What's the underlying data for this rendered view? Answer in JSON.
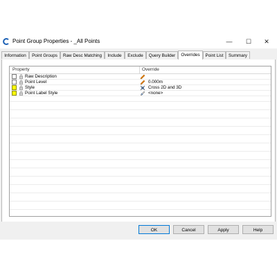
{
  "window": {
    "title": "Point Group Properties - _All Points",
    "controls": {
      "minimize": "—",
      "maximize": "☐",
      "close": "✕"
    }
  },
  "tabs": [
    {
      "label": "Information",
      "active": false
    },
    {
      "label": "Point Groups",
      "active": false
    },
    {
      "label": "Raw Desc Matching",
      "active": false
    },
    {
      "label": "Include",
      "active": false
    },
    {
      "label": "Exclude",
      "active": false
    },
    {
      "label": "Query Builder",
      "active": false
    },
    {
      "label": "Overrides",
      "active": true
    },
    {
      "label": "Point List",
      "active": false
    },
    {
      "label": "Summary",
      "active": false
    }
  ],
  "overrides": {
    "columns": {
      "property": "Property",
      "override": "Override"
    },
    "rows": [
      {
        "property": "Raw Description",
        "override": "",
        "checked": false,
        "highlighted": false,
        "override_icon": "pencil-icon"
      },
      {
        "property": "Point Level",
        "override": "0.000m",
        "checked": false,
        "highlighted": false,
        "override_icon": "pencil-icon"
      },
      {
        "property": "Style",
        "override": "Cross 2D and 3D",
        "checked": false,
        "highlighted": true,
        "override_icon": "point-style-icon"
      },
      {
        "property": "Point Label Style",
        "override": "<none>",
        "checked": false,
        "highlighted": true,
        "override_icon": "label-style-icon"
      }
    ]
  },
  "buttons": {
    "ok": "OK",
    "cancel": "Cancel",
    "apply": "Apply",
    "help": "Help"
  },
  "colors": {
    "highlight": "#ffff00",
    "accent": "#0078d7",
    "pencil": "#e07b00"
  }
}
